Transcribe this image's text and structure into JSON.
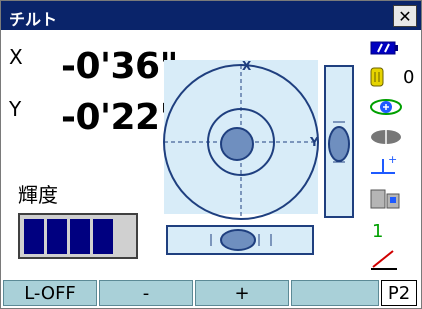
{
  "window": {
    "title": "チルト"
  },
  "readings": {
    "x_label": "X",
    "x_value": "-0'36\"",
    "y_label": "Y",
    "y_value": "-0'22\""
  },
  "brightness": {
    "label": "輝度",
    "level": 4,
    "max": 5
  },
  "tilt_display": {
    "x_axis_label": "X",
    "y_axis_label": "Y"
  },
  "status_icons": {
    "battery_text": "0",
    "battery_icon": "battery-icon",
    "recording_icon": "recording-icon",
    "prism_icon": "prism-icon",
    "target_icon": "target-icon",
    "instrument_icon": "instrument-icon",
    "level_text": "1",
    "pen_icon": "pen-icon",
    "colors": {
      "accent": "#000080",
      "icon_green": "#00a000",
      "icon_blue": "#1e5aff"
    }
  },
  "softkeys": [
    "L-OFF",
    "-",
    "+",
    "",
    "P2"
  ],
  "colors": {
    "title_bar": "#0a246a",
    "panel_bg": "#d8ecf8",
    "bubble_fill": "#6f8fbf",
    "softkey_bg": "#a9d0d8",
    "bar_fill": "#000080"
  }
}
